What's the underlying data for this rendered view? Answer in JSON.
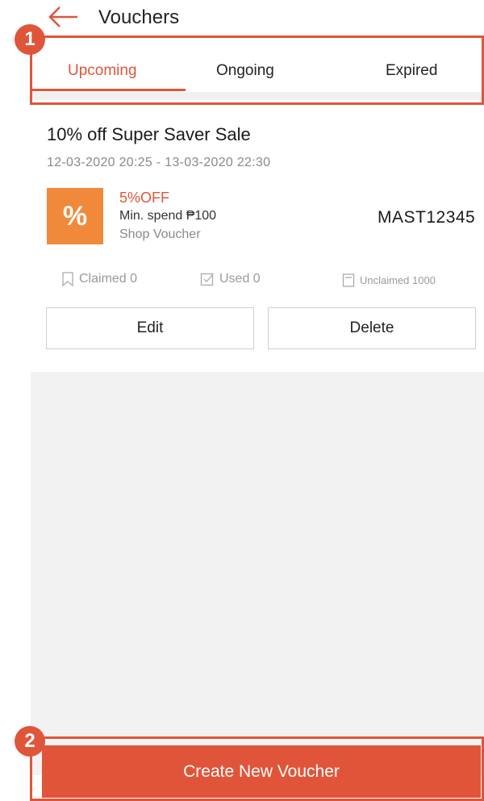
{
  "header": {
    "title": "Vouchers"
  },
  "tabs": [
    {
      "label": "Upcoming",
      "active": true
    },
    {
      "label": "Ongoing",
      "active": false
    },
    {
      "label": "Expired",
      "active": false
    }
  ],
  "voucher": {
    "title": "10% off Super Saver Sale",
    "dates": "12-03-2020 20:25 - 13-03-2020 22:30",
    "badge_symbol": "%",
    "discount": "5%OFF",
    "min_spend": "Min. spend ₱100",
    "type": "Shop Voucher",
    "code": "MAST12345",
    "stats": {
      "claimed": "Claimed 0",
      "used": "Used 0",
      "unclaimed": "Unclaimed 1000"
    },
    "edit_label": "Edit",
    "delete_label": "Delete"
  },
  "footer": {
    "create_label": "Create New Voucher"
  },
  "annotations": {
    "marker_1": "1",
    "marker_2": "2"
  },
  "colors": {
    "accent": "#e0553a",
    "badge": "#f08a3a"
  },
  "icons": [
    "back-arrow-icon",
    "bookmark-icon",
    "check-icon",
    "clipboard-icon"
  ]
}
